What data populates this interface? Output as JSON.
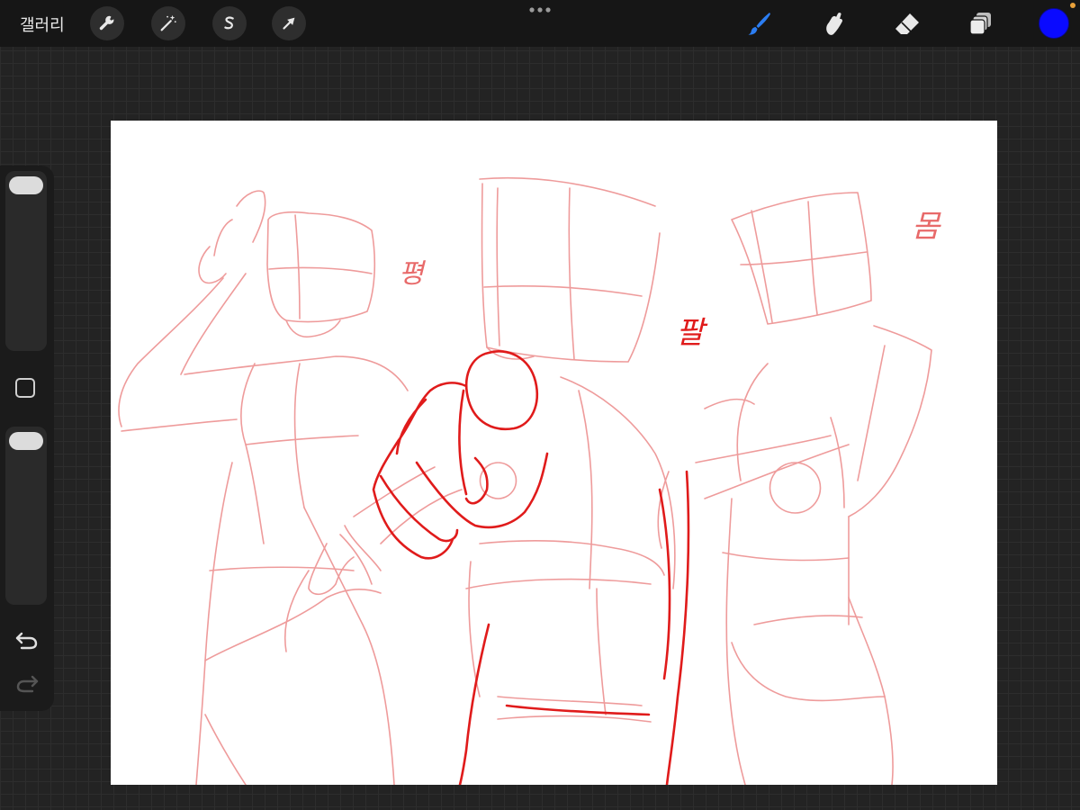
{
  "topbar": {
    "gallery_label": "갤러리",
    "left_tools": [
      {
        "icon": "wrench-icon",
        "name": "actions"
      },
      {
        "icon": "magic-wand-icon",
        "name": "adjustments"
      },
      {
        "icon": "selection-s-icon",
        "name": "selection"
      },
      {
        "icon": "arrow-cursor-icon",
        "name": "transform"
      }
    ],
    "more_icon": "three-dots-icon",
    "right_tools": [
      {
        "icon": "brush-icon",
        "name": "paint",
        "active": true
      },
      {
        "icon": "smudge-icon",
        "name": "smudge",
        "active": false
      },
      {
        "icon": "eraser-icon",
        "name": "erase",
        "active": false
      },
      {
        "icon": "layers-icon",
        "name": "layers",
        "active": false
      }
    ],
    "current_color": "#0a0aff",
    "notification_color": "#e9a13a"
  },
  "sidebar": {
    "brush_size_level": 0.0,
    "opacity_level": 0.0,
    "modify_button_icon": "square-outline-icon",
    "undo_icon": "undo-arrow-icon",
    "redo_icon": "redo-arrow-icon"
  },
  "canvas": {
    "background": "#ffffff",
    "sketch_light_color": "#ec8a8a",
    "sketch_strong_color": "#e01b1b",
    "notes": [
      {
        "text": "평",
        "color": "#e86a6a"
      },
      {
        "text": "팔",
        "color": "#e01b1b"
      },
      {
        "text": "몸",
        "color": "#e86a6a"
      }
    ]
  }
}
